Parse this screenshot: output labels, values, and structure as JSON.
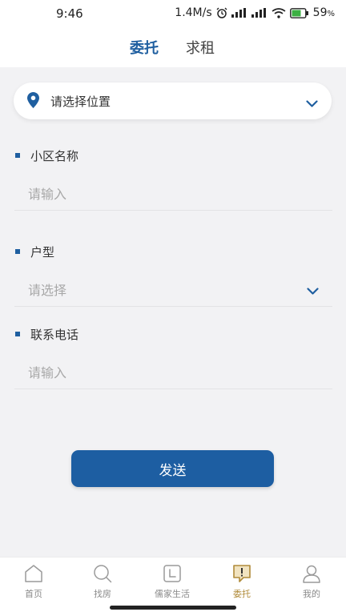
{
  "status_bar": {
    "time": "9:46",
    "speed": "1.4M/s",
    "battery": "59"
  },
  "header": {
    "tabs": [
      {
        "label": "委托",
        "active": true
      },
      {
        "label": "求租",
        "active": false
      }
    ]
  },
  "location": {
    "placeholder": "请选择位置",
    "icon": "location-pin-icon"
  },
  "form": {
    "community_name": {
      "label": "小区名称",
      "placeholder": "请输入"
    },
    "layout": {
      "label": "户型",
      "placeholder": "请选择"
    },
    "phone": {
      "label": "联系电话",
      "placeholder": "请输入"
    }
  },
  "submit": {
    "label": "发送"
  },
  "tabbar": {
    "items": [
      {
        "label": "首页",
        "icon": "home-icon"
      },
      {
        "label": "找房",
        "icon": "search-icon"
      },
      {
        "label": "儒家生活",
        "icon": "life-icon"
      },
      {
        "label": "委托",
        "icon": "commission-icon",
        "active": true
      },
      {
        "label": "我的",
        "icon": "profile-icon"
      }
    ]
  },
  "colors": {
    "accent": "#1f5fa0",
    "button": "#1d5ea2",
    "tab_active": "#b08b3a",
    "background": "#f2f2f4"
  }
}
